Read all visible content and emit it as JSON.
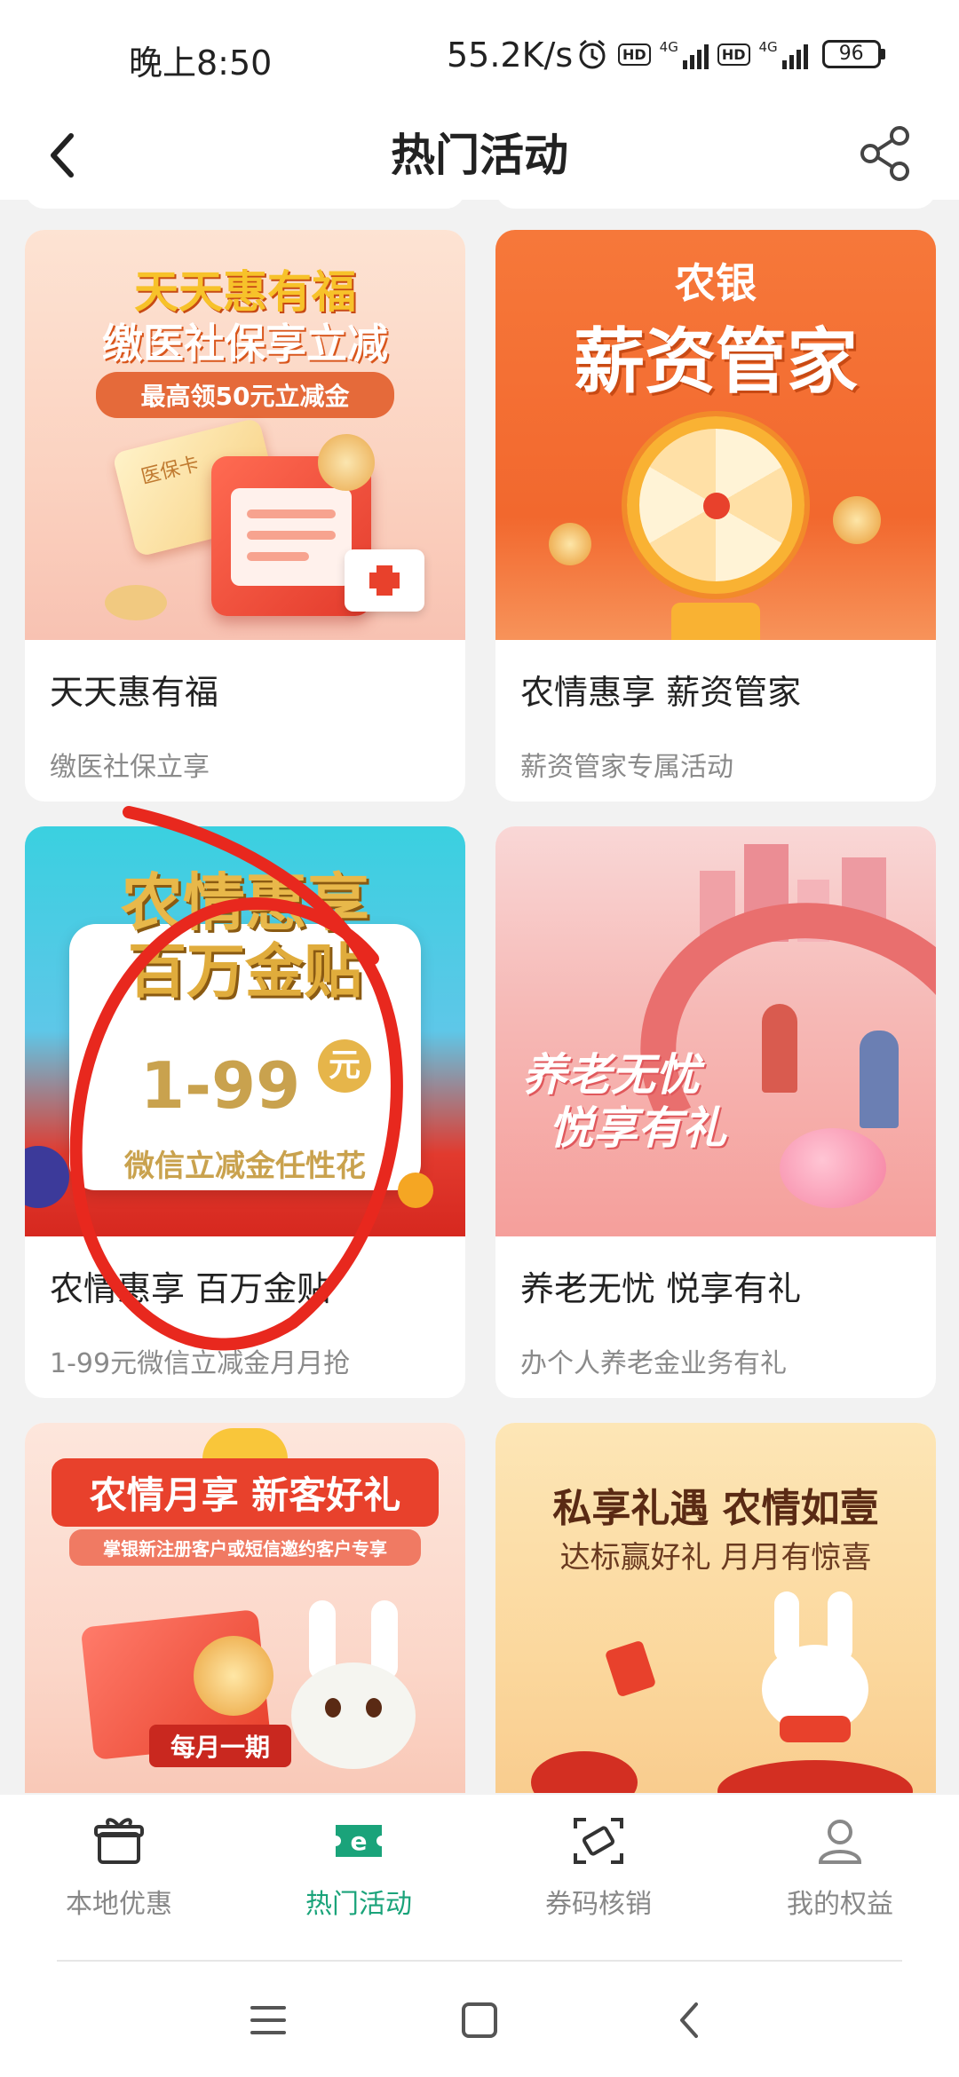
{
  "status_bar": {
    "time": "晚上8:50",
    "speed": "55.2K/s",
    "network_1": "4G",
    "network_2": "4G",
    "battery": "96"
  },
  "header": {
    "title": "热门活动"
  },
  "cards": [
    {
      "title": "天天惠有福",
      "subtitle": "缴医社保立享",
      "banner_line1": "天天惠有福",
      "banner_line2": "缴医社保享立减",
      "banner_line3": "最高领50元立减金",
      "banner_card": "医保卡"
    },
    {
      "title": "农情惠享 薪资管家",
      "subtitle": "薪资管家专属活动",
      "banner_line1": "农银",
      "banner_line2": "薪资管家"
    },
    {
      "title": "农情惠享 百万金贴",
      "subtitle": "1-99元微信立减金月月抢",
      "banner_line1": "农情惠享",
      "banner_line2": "百万金贴",
      "banner_amount": "1-99",
      "banner_unit": "元",
      "banner_line3": "微信立减金任性花"
    },
    {
      "title": "养老无忧 悦享有礼",
      "subtitle": "办个人养老金业务有礼",
      "banner_line1": "养老无忧",
      "banner_line2": "悦享有礼"
    },
    {
      "title": "",
      "subtitle": "",
      "banner_line1": "农情月享 新客好礼",
      "banner_line2": "掌银新注册客户或短信邀约客户专享",
      "banner_line3": "每月一期"
    },
    {
      "title": "",
      "subtitle": "",
      "banner_line1": "私享礼遇 农情如壹",
      "banner_line2": "达标赢好礼 月月有惊喜"
    }
  ],
  "bottom_nav": [
    {
      "label": "本地优惠",
      "icon": "gift-icon",
      "active": false
    },
    {
      "label": "热门活动",
      "icon": "ticket-e-icon",
      "active": true
    },
    {
      "label": "券码核销",
      "icon": "scan-coupon-icon",
      "active": false
    },
    {
      "label": "我的权益",
      "icon": "user-icon",
      "active": false
    }
  ],
  "colors": {
    "accent": "#1aa37a",
    "annotation": "#e8281e"
  }
}
